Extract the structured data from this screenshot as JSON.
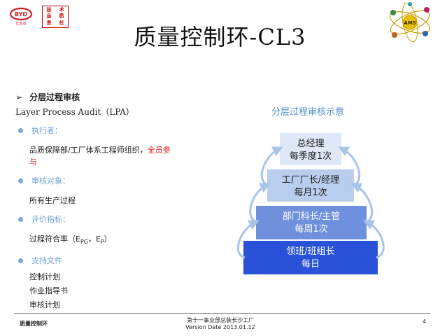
{
  "header": {
    "byd_text": "BYD",
    "byd_sub": "比亚迪",
    "motto": [
      "技",
      "术",
      "品",
      "质",
      "责",
      "任"
    ],
    "ams_text": "AMS"
  },
  "title": "质量控制环-CL3",
  "left": {
    "heading": "分层过程审核",
    "subheading": "Layer  Process  Audit（LPA）",
    "executor_label": "执行者：",
    "executor_text": "品质保障部/工厂体系工程师组织，",
    "executor_red_1": "全员参",
    "executor_red_2": "与",
    "target_label": "审核对象：",
    "target_text": "所有生产过程",
    "metric_label": "评价指标：",
    "metric_text_prefix": "过程符合率（E",
    "metric_sub_1": "PG",
    "metric_mid": "，E",
    "metric_sub_2": "P",
    "metric_suffix": "）",
    "support_label": "支持文件",
    "support_items": [
      "控制计划",
      "作业指导书",
      "审核计划"
    ]
  },
  "diagram": {
    "title": "分层过程审核示意",
    "levels": [
      {
        "line1": "总经理",
        "line2": "每季度1次",
        "color": "#dfe8f7",
        "text_color": "#1a1a1a"
      },
      {
        "line1": "工厂厂长/经理",
        "line2": "每月1次",
        "color": "#b9cdee",
        "text_color": "#1a1a1a"
      },
      {
        "line1": "部门科长/主管",
        "line2": "每周1次",
        "color": "#6f91dd",
        "text_color": "#ffffff"
      },
      {
        "line1": "领班/班组长",
        "line2": "每日",
        "color": "#2a52d8",
        "text_color": "#ffffff"
      }
    ],
    "arrow_color": "#a8c4e8"
  },
  "footer": {
    "left": "质量控制环",
    "center_line1": "第十一事业部总装长沙工厂",
    "center_line2": "Version Date 2013.01.12",
    "page": "4"
  }
}
